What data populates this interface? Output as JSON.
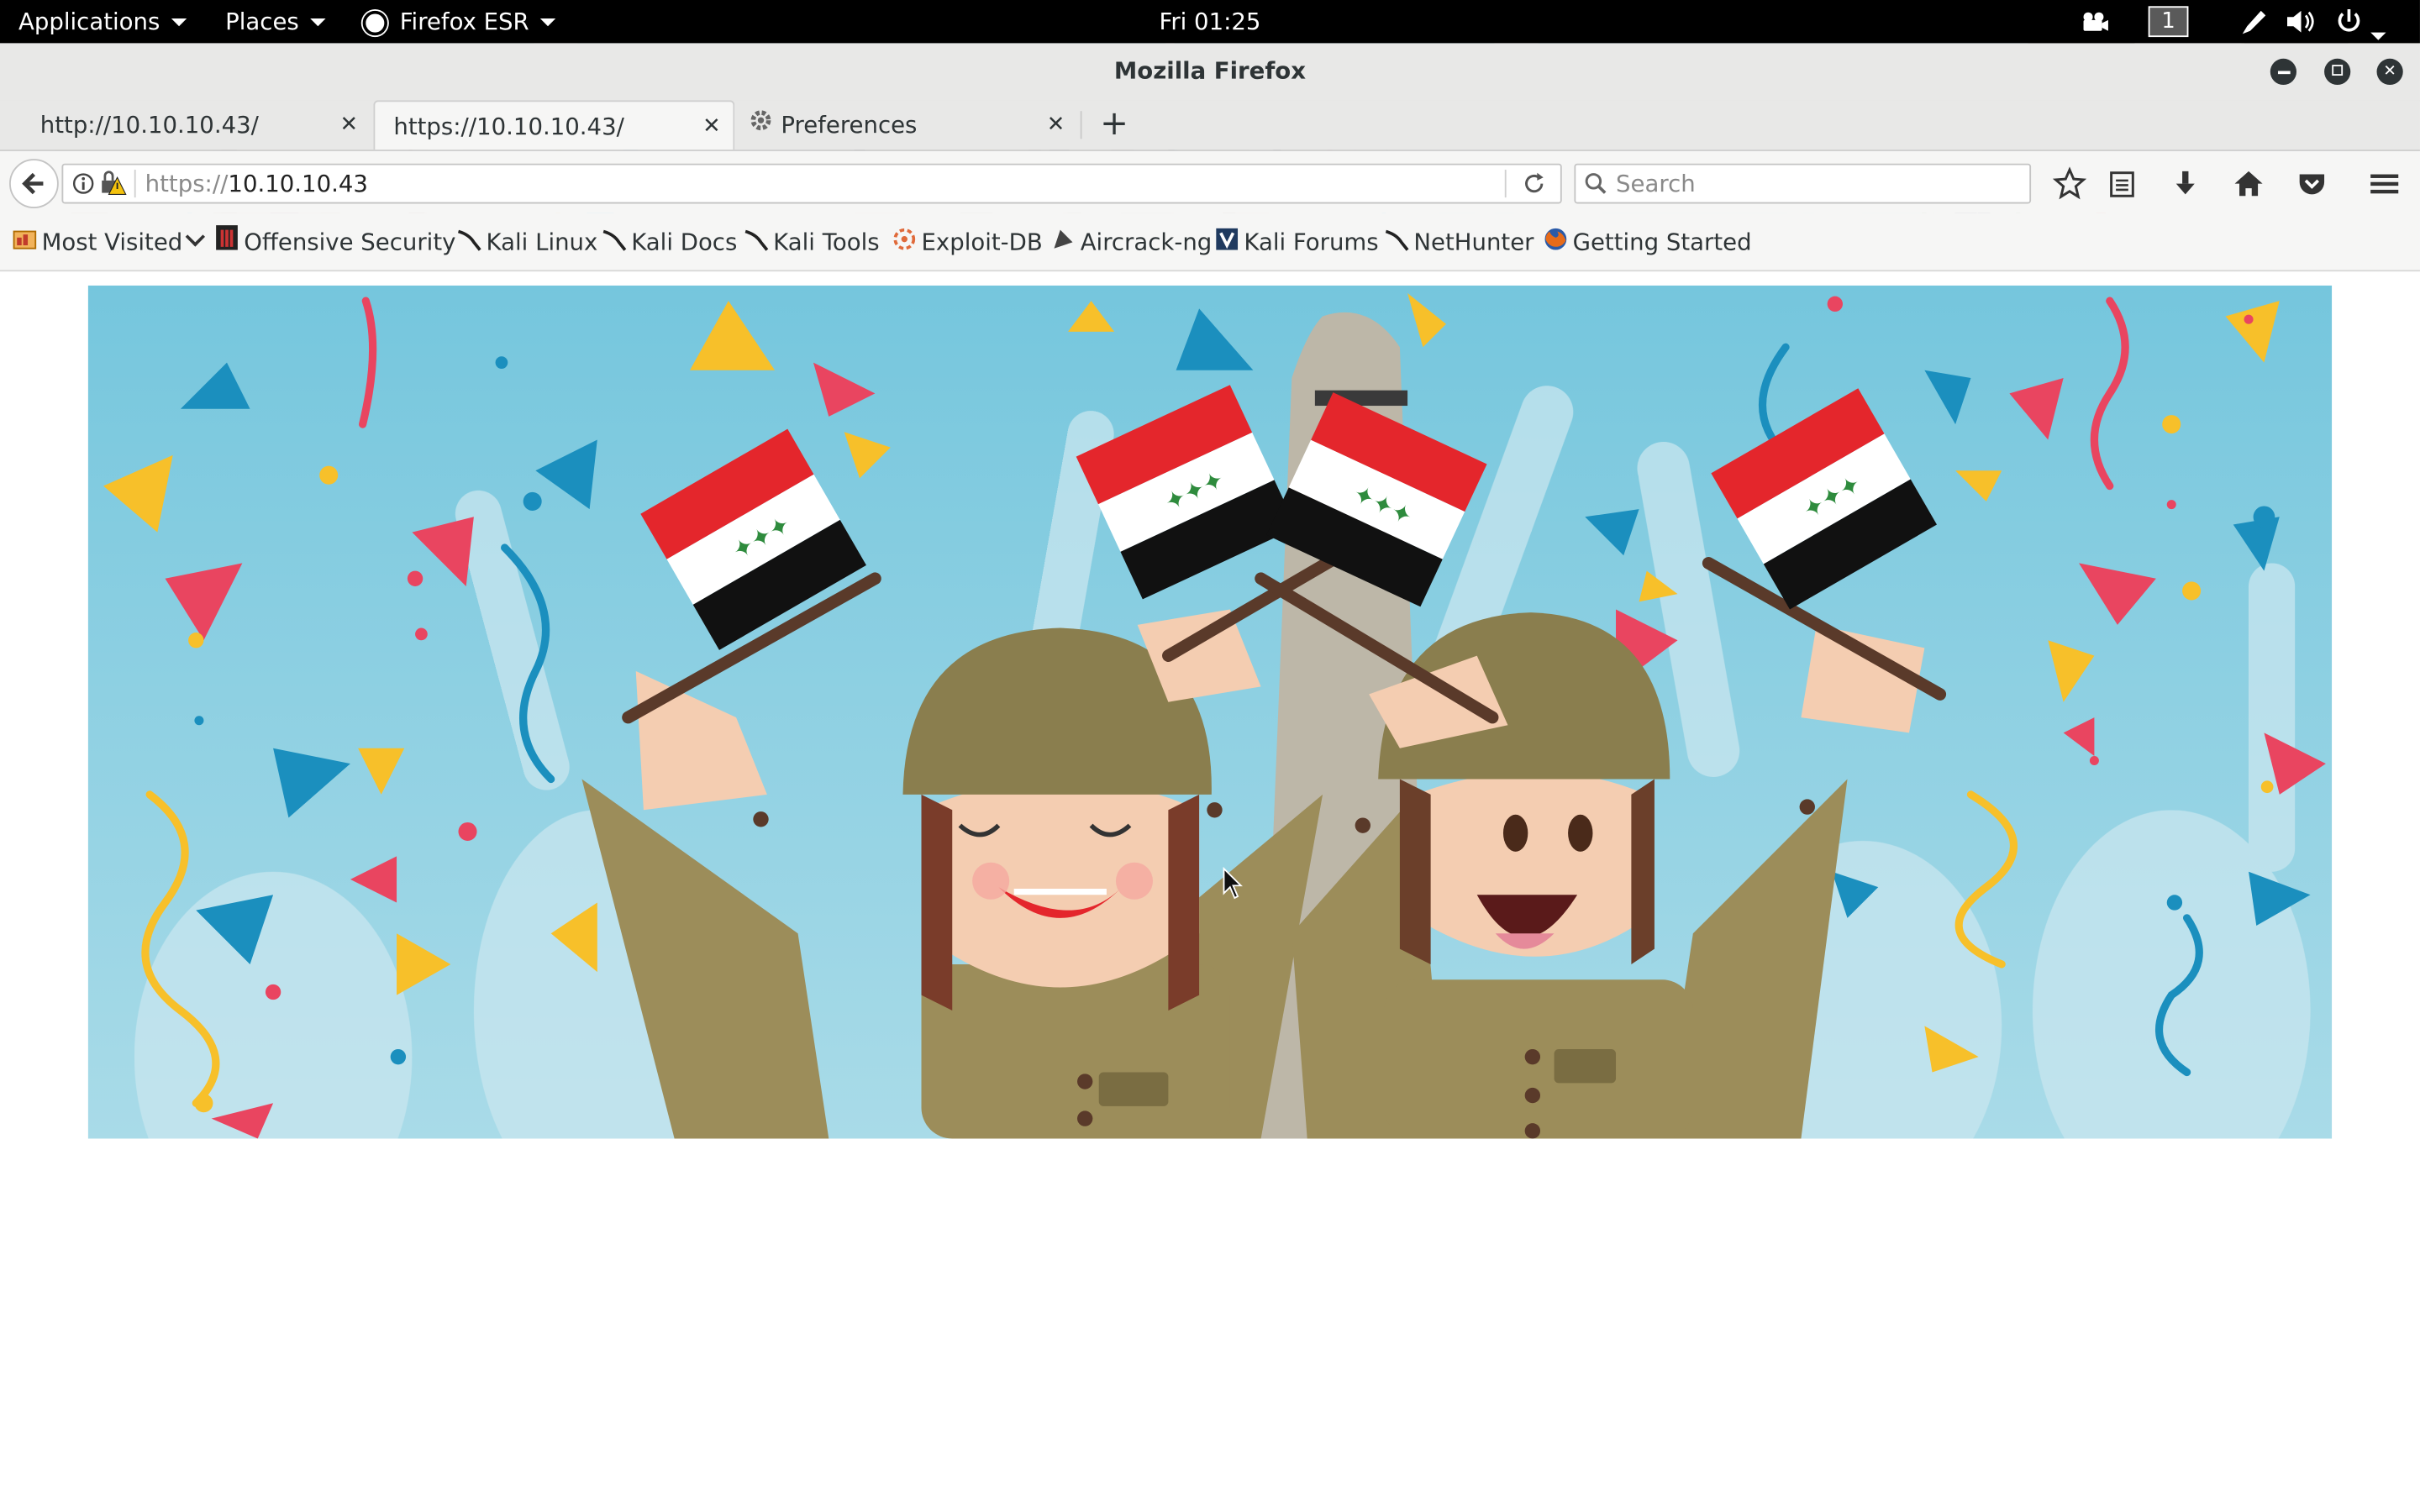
{
  "topbar": {
    "applications": "Applications",
    "places": "Places",
    "firefox_esr": "Firefox ESR",
    "clock": "Fri 01:25",
    "workspace": "1"
  },
  "window": {
    "title": "Mozilla Firefox"
  },
  "tabs": [
    {
      "label": "http://10.10.10.43/",
      "active": false
    },
    {
      "label": "https://10.10.10.43/",
      "active": true
    },
    {
      "label": "Preferences",
      "active": false,
      "icon": "gear-icon"
    }
  ],
  "navbar": {
    "url_prefix": "https://",
    "url_host": "10.10.10.43",
    "search_placeholder": "Search"
  },
  "bookmarks": [
    {
      "label": "Most Visited",
      "icon": "most-visited-icon"
    },
    {
      "label": "Offensive Security",
      "icon": "offsec-icon"
    },
    {
      "label": "Kali Linux",
      "icon": "kali-icon"
    },
    {
      "label": "Kali Docs",
      "icon": "kali-icon"
    },
    {
      "label": "Kali Tools",
      "icon": "kali-icon"
    },
    {
      "label": "Exploit-DB",
      "icon": "exploitdb-icon"
    },
    {
      "label": "Aircrack-ng",
      "icon": "aircrack-icon"
    },
    {
      "label": "Kali Forums",
      "icon": "kali-forums-icon"
    },
    {
      "label": "NetHunter",
      "icon": "kali-icon"
    },
    {
      "label": "Getting Started",
      "icon": "firefox-icon"
    }
  ],
  "colors": {
    "sky": "#7ec8dc",
    "flag_red": "#e4262c",
    "flag_green": "#2e8b3d",
    "uniform": "#9c8d5a",
    "helmet": "#8a7e4e"
  }
}
